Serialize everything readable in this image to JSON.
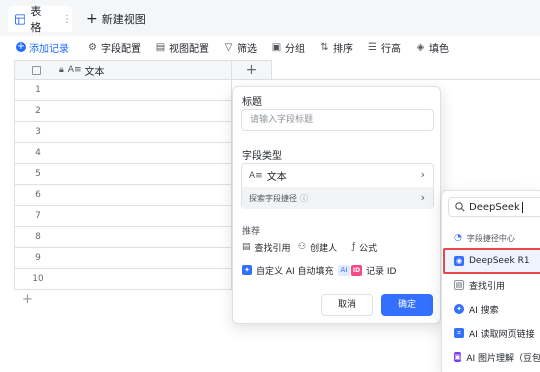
{
  "view_bar": {
    "tab_label": "表格",
    "tab_more": "⋮",
    "new_view_label": "新建视图"
  },
  "toolbar": {
    "add_record": "添加记录",
    "field_config": "字段配置",
    "view_config": "视图配置",
    "filter": "筛选",
    "group": "分组",
    "sort": "排序",
    "row_height": "行高",
    "fill_color": "填色"
  },
  "grid": {
    "column_label": "文本",
    "column_type_glyph": "A≡",
    "row_numbers": [
      "1",
      "2",
      "3",
      "4",
      "5",
      "6",
      "7",
      "8",
      "9",
      "10"
    ]
  },
  "field_panel": {
    "title_section": "标题",
    "title_placeholder": "请输入字段标题",
    "type_section": "字段类型",
    "type_glyph": "A≡",
    "selected_type": "文本",
    "explore_label": "探索字段捷径",
    "recommend_section": "推荐",
    "recommended": {
      "lookup": "查找引用",
      "creator": "创建人",
      "formula": "公式",
      "ai_autofill": "自定义 AI 自动填充",
      "ai_tag": "AI",
      "record_id": "记录 ID",
      "record_id_badge": "ID"
    },
    "cancel": "取消",
    "confirm": "确定"
  },
  "type_dropdown": {
    "search_value": "DeepSeek",
    "items": [
      {
        "label": "字段捷径中心",
        "kind": "group"
      },
      {
        "label": "DeepSeek R1",
        "kind": "item",
        "selected": true
      },
      {
        "label": "查找引用",
        "kind": "item"
      },
      {
        "label": "AI 搜索",
        "kind": "item"
      },
      {
        "label": "AI 读取网页链接",
        "kind": "item"
      },
      {
        "label": "AI 图片理解（豆包",
        "kind": "item"
      }
    ]
  },
  "colors": {
    "accent": "#3370ff",
    "highlight_border": "#e54848",
    "record_id": "#f54a87"
  }
}
